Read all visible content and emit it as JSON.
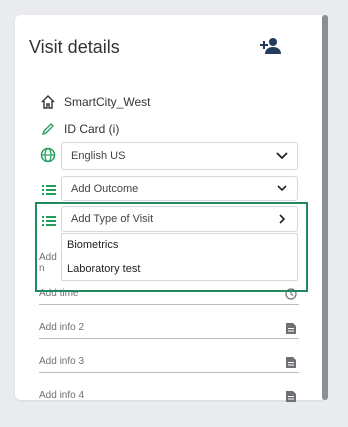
{
  "title": "Visit details",
  "add_person_icon": "person-add-icon",
  "location": {
    "icon": "home-icon",
    "text": "SmartCity_West"
  },
  "id_card": {
    "icon": "pencil-icon",
    "text": "ID Card (i)"
  },
  "language": {
    "icon": "globe-icon",
    "value": "English US"
  },
  "outcome": {
    "icon": "list-icon",
    "placeholder": "Add Outcome"
  },
  "type_of_visit": {
    "icon": "list-icon",
    "placeholder": "Add Type of Visit",
    "options": [
      "Biometrics",
      "Laboratory test"
    ]
  },
  "fields": {
    "field1_placeholder": "Add n",
    "time_placeholder": "Add time",
    "info2_placeholder": "Add info 2",
    "info3_placeholder": "Add info 3",
    "info4_placeholder": "Add info 4"
  },
  "colors": {
    "accent_green": "#1f8a5c",
    "background": "#e9ebee",
    "panel": "#ffffff",
    "icon_navy": "#23395d",
    "globe_green": "#1e9e5a"
  }
}
